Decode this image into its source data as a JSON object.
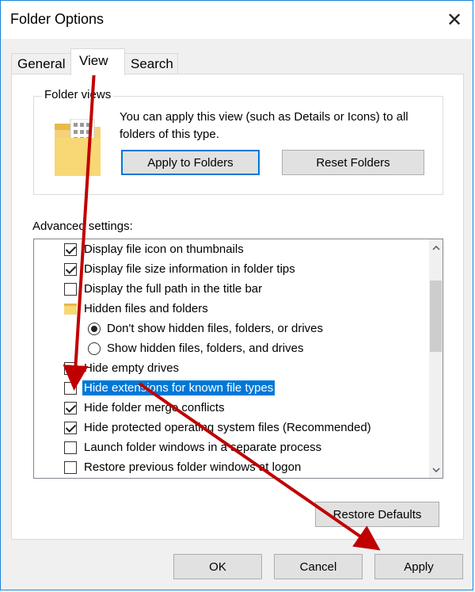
{
  "window": {
    "title": "Folder Options",
    "close_glyph": "✕"
  },
  "tabs": [
    {
      "label": "General"
    },
    {
      "label": "View"
    },
    {
      "label": "Search"
    }
  ],
  "folder_views": {
    "legend": "Folder views",
    "description": "You can apply this view (such as Details or Icons) to all folders of this type.",
    "apply_button": "Apply to Folders",
    "reset_button": "Reset Folders"
  },
  "advanced": {
    "label": "Advanced settings:",
    "items": [
      {
        "type": "checkbox",
        "checked": true,
        "label": "Display file icon on thumbnails"
      },
      {
        "type": "checkbox",
        "checked": true,
        "label": "Display file size information in folder tips"
      },
      {
        "type": "checkbox",
        "checked": false,
        "label": "Display the full path in the title bar"
      },
      {
        "type": "folder",
        "label": "Hidden files and folders"
      },
      {
        "type": "radio",
        "checked": true,
        "label": "Don't show hidden files, folders, or drives"
      },
      {
        "type": "radio",
        "checked": false,
        "label": "Show hidden files, folders, and drives"
      },
      {
        "type": "checkbox",
        "checked": true,
        "label": "Hide empty drives"
      },
      {
        "type": "checkbox",
        "checked": false,
        "label": "Hide extensions for known file types",
        "selected": true
      },
      {
        "type": "checkbox",
        "checked": true,
        "label": "Hide folder merge conflicts"
      },
      {
        "type": "checkbox",
        "checked": true,
        "label": "Hide protected operating system files (Recommended)"
      },
      {
        "type": "checkbox",
        "checked": false,
        "label": "Launch folder windows in a separate process"
      },
      {
        "type": "checkbox",
        "checked": false,
        "label": "Restore previous folder windows at logon"
      }
    ],
    "restore_defaults": "Restore Defaults"
  },
  "footer": {
    "ok": "OK",
    "cancel": "Cancel",
    "apply": "Apply"
  },
  "colors": {
    "accent": "#0078d7",
    "annotation_arrow": "#c00000"
  }
}
